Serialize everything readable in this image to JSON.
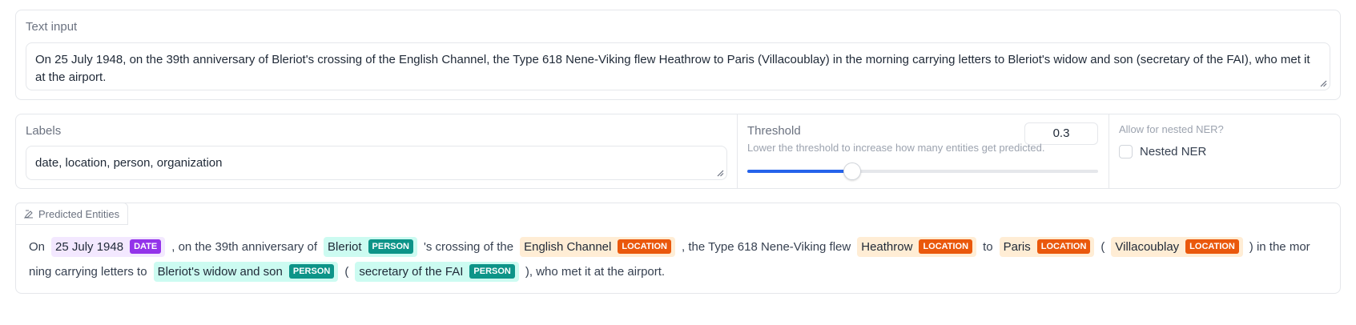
{
  "text_input": {
    "label": "Text input",
    "value": "On 25 July 1948, on the 39th anniversary of Bleriot's crossing of the English Channel, the Type 618 Nene-Viking flew Heathrow to Paris (Villacoublay) in the morning carrying letters to Bleriot's widow and son (secretary of the FAI), who met it at the airport."
  },
  "labels_field": {
    "label": "Labels",
    "value": "date, location, person, organization"
  },
  "threshold": {
    "label": "Threshold",
    "info": "Lower the threshold to increase how many entities get predicted.",
    "value": "0.3",
    "fraction": 0.3
  },
  "nested": {
    "label": "Allow for nested NER?",
    "checkbox_label": "Nested NER",
    "checked": false
  },
  "predicted": {
    "label": "Predicted Entities",
    "line1": [
      {
        "text": "On"
      },
      {
        "text": "25 July 1948",
        "tag": "DATE"
      },
      {
        "text": ", on the 39th anniversary of"
      },
      {
        "text": "Bleriot",
        "tag": "PERSON"
      },
      {
        "text": "'s crossing of the"
      },
      {
        "text": "English Channel",
        "tag": "LOCATION"
      },
      {
        "text": ", the Type 618 Nene-Viking flew"
      },
      {
        "text": "Heathrow",
        "tag": "LOCATION"
      },
      {
        "text": "to"
      },
      {
        "text": "Paris",
        "tag": "LOCATION"
      },
      {
        "text": "("
      },
      {
        "text": "Villacoublay",
        "tag": "LOCATION"
      },
      {
        "text": ") in the mor"
      }
    ],
    "line2": [
      {
        "text": "ning carrying letters to"
      },
      {
        "text": "Bleriot's widow and son",
        "tag": "PERSON"
      },
      {
        "text": "("
      },
      {
        "text": "secretary of the FAI",
        "tag": "PERSON"
      },
      {
        "text": "), who met it at the airport."
      }
    ]
  },
  "colors": {
    "DATE": {
      "bg": "#f3e8ff",
      "tag": "#9333ea"
    },
    "PERSON": {
      "bg": "#ccfbf1",
      "tag": "#0d9488"
    },
    "LOCATION": {
      "bg": "#ffedd5",
      "tag": "#ea580c"
    },
    "accent": "#2563eb"
  }
}
